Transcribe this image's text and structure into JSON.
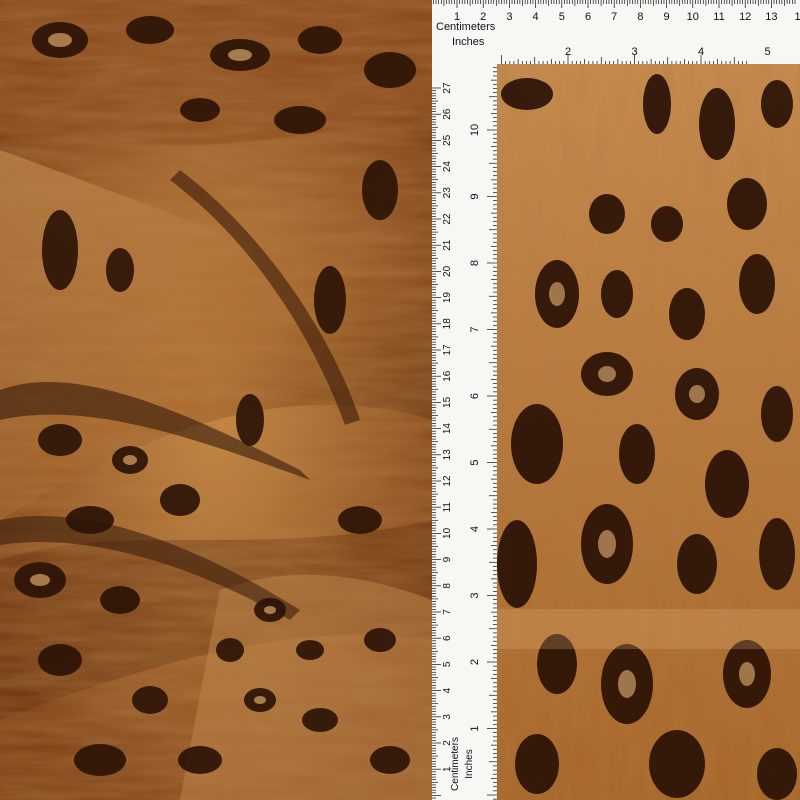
{
  "rulers": {
    "centimeters_label": "Centimeters",
    "inches_label": "Inches",
    "top_cm_numbers": [
      "1",
      "2",
      "3",
      "4",
      "5",
      "6",
      "7",
      "8",
      "9",
      "10",
      "11",
      "12",
      "13",
      "1"
    ],
    "top_in_numbers": [
      "2",
      "3",
      "4",
      "5"
    ],
    "side_cm_numbers": [
      "27",
      "26",
      "25",
      "24",
      "23",
      "22",
      "21",
      "20",
      "19",
      "18",
      "17",
      "16",
      "15",
      "14",
      "13",
      "12",
      "11",
      "10",
      "9",
      "8",
      "7",
      "6",
      "5",
      "4",
      "3",
      "2",
      "1"
    ],
    "side_in_numbers": [
      "10",
      "9",
      "8",
      "7",
      "6",
      "5",
      "4",
      "3",
      "2",
      "1"
    ]
  },
  "colors": {
    "fur_base": "#b06a2a",
    "fur_light": "#e0b27a",
    "fur_dark": "#2a1206",
    "fur_mid": "#7a3a12",
    "ruler_bg": "#f7f7f4",
    "ruler_ink": "#111111"
  }
}
